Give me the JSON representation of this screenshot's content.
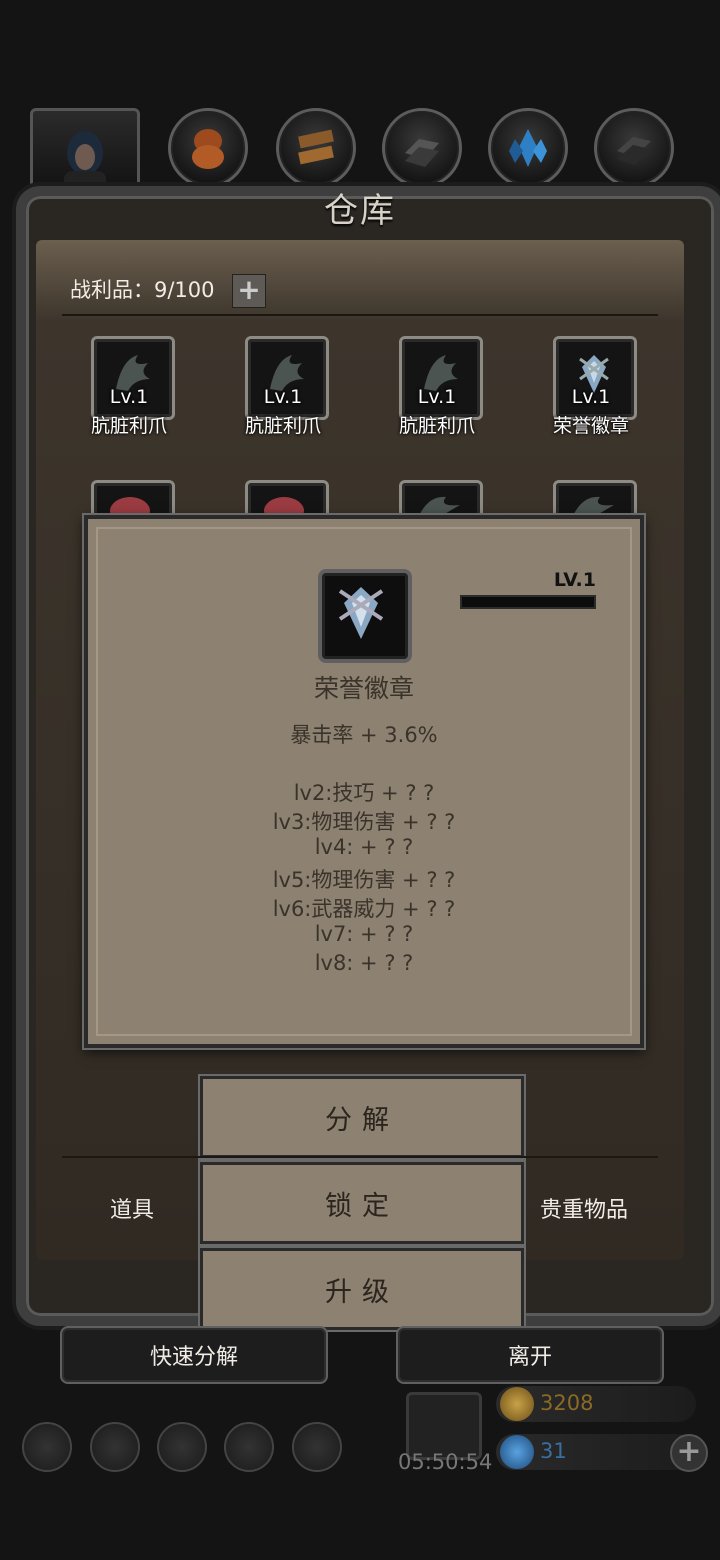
{
  "header": {
    "title": "仓库",
    "tabs": [
      {
        "icon": "character-portrait"
      },
      {
        "icon": "leather-material-icon"
      },
      {
        "icon": "wood-planks-icon"
      },
      {
        "icon": "iron-ingot-icon"
      },
      {
        "icon": "blue-crystal-icon"
      },
      {
        "icon": "dark-metal-icon"
      }
    ]
  },
  "inventory": {
    "slot_label": "战利品：9/100",
    "add_symbol": "+",
    "items": [
      {
        "level": "Lv.1",
        "name": "肮脏利爪",
        "icon": "claw-icon"
      },
      {
        "level": "Lv.1",
        "name": "肮脏利爪",
        "icon": "claw-icon"
      },
      {
        "level": "Lv.1",
        "name": "肮脏利爪",
        "icon": "claw-icon"
      },
      {
        "level": "Lv.1",
        "name": "荣誉徽章",
        "icon": "badge-icon"
      }
    ]
  },
  "popup": {
    "level": "LV.1",
    "title": "荣誉徽章",
    "stat": "暴击率 + 3.6%",
    "unlocks": [
      "lv2:技巧 + ? ?",
      "lv3:物理伤害 + ? ?",
      "lv4: + ? ?",
      "lv5:物理伤害 + ? ?",
      "lv6:武器威力 + ? ?",
      "lv7: + ? ?",
      "lv8: + ? ?"
    ]
  },
  "actions": {
    "decompose": "分解",
    "lock": "锁定",
    "upgrade": "升级"
  },
  "tabs_bottom": {
    "left": "道具",
    "right": "贵重物品"
  },
  "footer": {
    "quick_decompose": "快速分解",
    "leave": "离开"
  },
  "hud": {
    "timer": "05:50:54",
    "gold": "3208",
    "gems": "31",
    "plus": "+"
  },
  "colors": {
    "accent_gold": "#a07a2c",
    "gem_blue": "#2a6fb0",
    "parchment": "#8d8171"
  }
}
